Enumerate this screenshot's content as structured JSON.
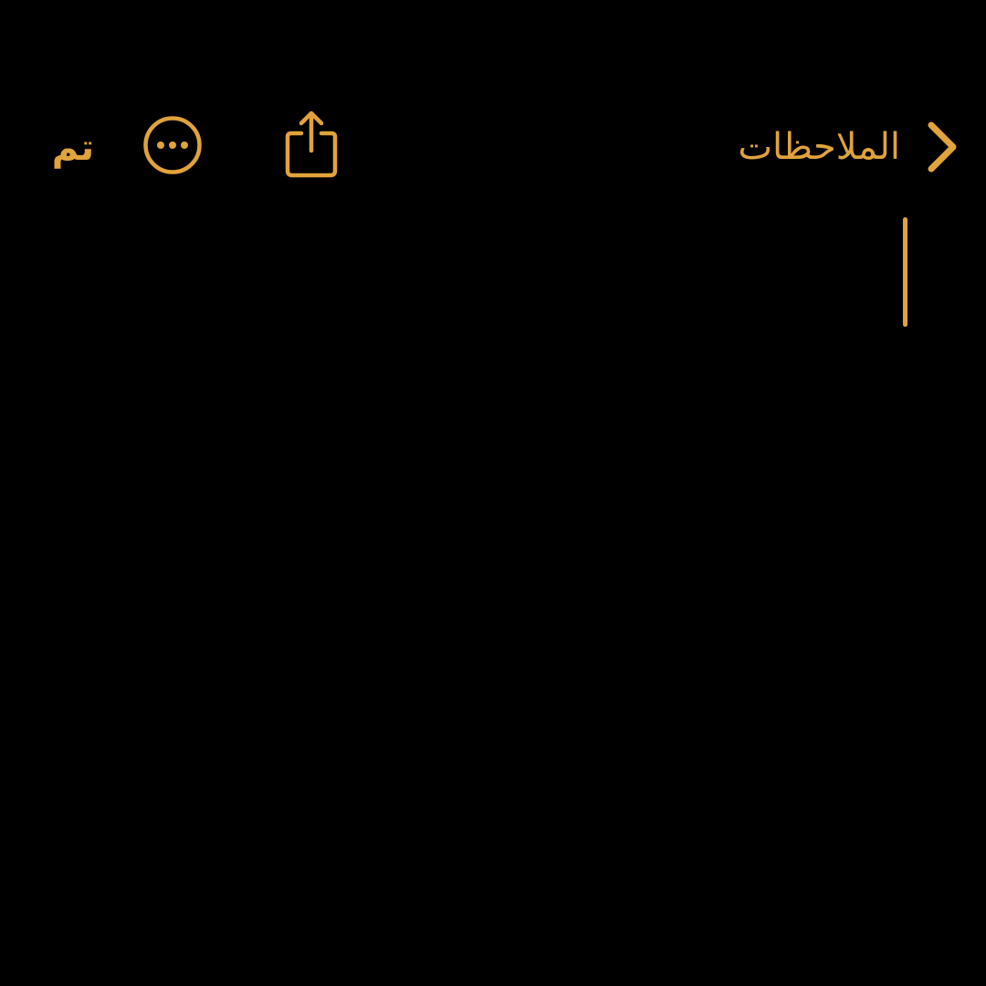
{
  "theme": {
    "accent_color": "#E1A33B",
    "background_color": "#000000"
  },
  "nav_bar": {
    "back_label": "الملاحظات",
    "back_icon": "chevron-right-icon",
    "share_icon": "share-icon",
    "more_icon": "ellipsis-circle-icon",
    "done_label": "تم"
  },
  "note": {
    "body_text": ""
  }
}
